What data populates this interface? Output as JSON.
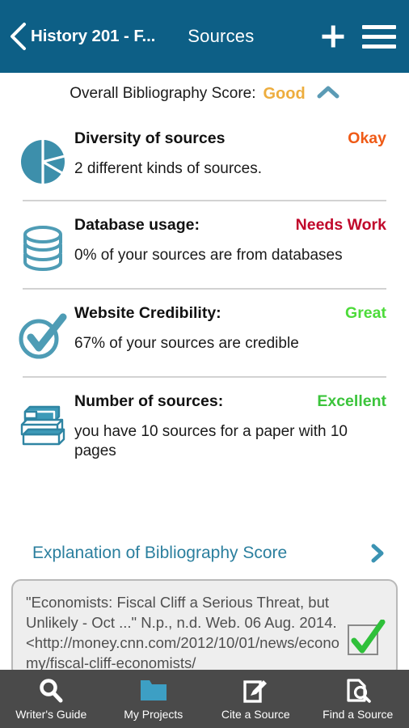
{
  "header": {
    "back_icon": "chevron-left-icon",
    "breadcrumb": "History 201 - F...",
    "title": "Sources",
    "add_icon": "plus-icon",
    "menu_icon": "hamburger-menu-icon"
  },
  "overall": {
    "label": "Overall Bibliography Score:",
    "value": "Good",
    "value_color": "#edad3e",
    "collapse_icon": "chevron-up-icon",
    "collapse_icon_color": "#5b9bb5"
  },
  "metrics": [
    {
      "icon": "pie-chart-icon",
      "title": "Diversity of sources",
      "status": "Okay",
      "status_color": "#ef5a16",
      "description": "2 different kinds of sources."
    },
    {
      "icon": "database-icon",
      "title": "Database usage:",
      "status": "Needs Work",
      "status_color": "#c1082b",
      "description": "0% of your sources are from databases"
    },
    {
      "icon": "check-circle-icon",
      "title": "Website Credibility:",
      "status": "Great",
      "status_color": "#4ddb3a",
      "description": "67% of your sources are credible"
    },
    {
      "icon": "book-stack-icon",
      "title": "Number of sources:",
      "status": "Excellent",
      "status_color": "#3bc43b",
      "description": "you have 10 sources for a paper with 10 pages"
    }
  ],
  "explanation": {
    "label": "Explanation of Bibliography Score",
    "chevron_icon": "chevron-right-icon",
    "color": "#2b7f9e"
  },
  "citation": {
    "text": "\"Economists: Fiscal Cliff a Serious Threat, but Unlikely - Oct ...\" N.p., n.d. Web. 06 Aug. 2014. <http://money.cnn.com/2012/10/01/news/economy/fiscal-cliff-economists/",
    "check_icon": "green-checkmark-icon",
    "check_color": "#2fc03a",
    "checked": true
  },
  "bottom_nav": {
    "active_index": 1,
    "active_color": "#3d9fc4",
    "items": [
      {
        "label": "Writer's Guide",
        "icon": "magnifier-icon"
      },
      {
        "label": "My Projects",
        "icon": "folder-icon"
      },
      {
        "label": "Cite a Source",
        "icon": "note-pencil-icon"
      },
      {
        "label": "Find a Source",
        "icon": "document-search-icon"
      }
    ]
  },
  "theme": {
    "appbar_bg": "#0d5f86",
    "nav_bg": "#4a4a4a",
    "teal": "#3d8fab",
    "divider": "#d2d2d2",
    "card_bg": "#eeeeee"
  }
}
